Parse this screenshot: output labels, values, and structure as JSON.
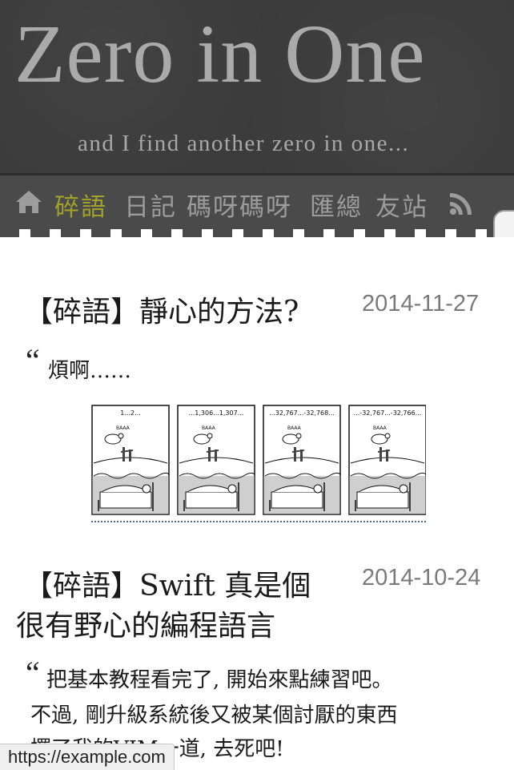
{
  "site": {
    "title": "Zero in One",
    "tagline": "and I find another zero in one..."
  },
  "nav": {
    "home_icon": "home-icon",
    "items": [
      {
        "label": "碎語",
        "active": true
      },
      {
        "label": "日記",
        "active": false
      },
      {
        "label": "碼呀碼呀",
        "active": false
      },
      {
        "label": "匯總",
        "active": false
      },
      {
        "label": "友站",
        "active": false
      }
    ],
    "rss_icon": "rss-icon",
    "active_color": "#a2a22a"
  },
  "posts": [
    {
      "title": "【碎語】靜心的方法?",
      "date": "2014-11-27",
      "body": [
        "煩啊……"
      ],
      "comic": {
        "panels": [
          "1...2...",
          "...1,306...1,307...",
          "...32,767...-32,768...",
          "...-32,767...-32,766..."
        ],
        "sound": "BAAA"
      }
    },
    {
      "title_line1": "【碎語】Swift 真是個",
      "title_line2": "很有野心的編程語言",
      "date": "2014-10-24",
      "body": [
        "把基本教程看完了, 開始來點練習吧。",
        "不過, 剛升級系統後又被某個討厭的東西",
        "擺了我的VIM一道, 去死吧!"
      ]
    }
  ],
  "status_bar": {
    "url": "https://example.com"
  }
}
